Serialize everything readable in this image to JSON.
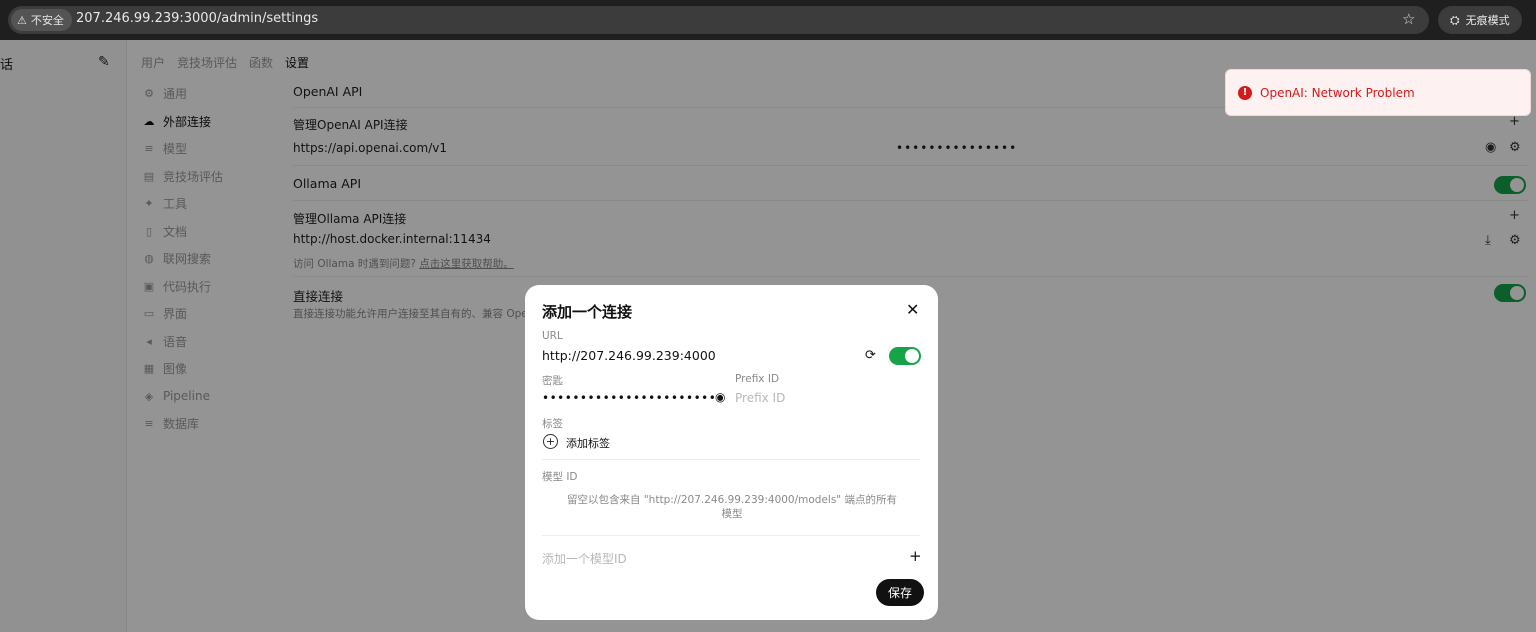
{
  "browser": {
    "security_label": "不安全",
    "url": "207.246.99.239:3000/admin/settings",
    "incognito_label": "无痕模式"
  },
  "sidebar": {
    "chat_label": "话"
  },
  "top_tabs": [
    "用户",
    "竞技场评估",
    "函数",
    "设置"
  ],
  "settings_nav": [
    {
      "icon": "gear-icon",
      "label": "通用"
    },
    {
      "icon": "cloud-icon",
      "label": "外部连接"
    },
    {
      "icon": "database-icon",
      "label": "模型"
    },
    {
      "icon": "document-icon",
      "label": "竞技场评估"
    },
    {
      "icon": "wrench-icon",
      "label": "工具"
    },
    {
      "icon": "file-icon",
      "label": "文档"
    },
    {
      "icon": "globe-icon",
      "label": "联网搜索"
    },
    {
      "icon": "code-icon",
      "label": "代码执行"
    },
    {
      "icon": "monitor-icon",
      "label": "界面"
    },
    {
      "icon": "speaker-icon",
      "label": "语音"
    },
    {
      "icon": "image-icon",
      "label": "图像"
    },
    {
      "icon": "pipeline-icon",
      "label": "Pipeline"
    },
    {
      "icon": "database-icon",
      "label": "数据库"
    }
  ],
  "connections": {
    "openai_title": "OpenAI API",
    "openai_manage": "管理OpenAI API连接",
    "openai_url": "https://api.openai.com/v1",
    "openai_key_masked": "•••••••••••••••",
    "ollama_title": "Ollama API",
    "ollama_manage": "管理Ollama API连接",
    "ollama_url": "http://host.docker.internal:11434",
    "ollama_hint": "访问 Ollama 时遇到问题?",
    "ollama_hint_link": "点击这里获取帮助。",
    "direct_title": "直接连接",
    "direct_desc": "直接连接功能允许用户连接至其自有的、兼容 Ope"
  },
  "toast": {
    "message": "OpenAI: Network Problem"
  },
  "modal": {
    "title": "添加一个连接",
    "url_label": "URL",
    "url_value": "http://207.246.99.239:4000",
    "key_label": "密匙",
    "key_masked": "••••••••••••••••••••••••",
    "prefix_label": "Prefix ID",
    "prefix_placeholder": "Prefix ID",
    "tags_label": "标签",
    "add_tag_label": "添加标签",
    "model_id_label": "模型 ID",
    "model_hint": "留空以包含来自 \"http://207.246.99.239:4000/models\" 端点的所有模型",
    "add_model_placeholder": "添加一个模型ID",
    "save_label": "保存"
  }
}
